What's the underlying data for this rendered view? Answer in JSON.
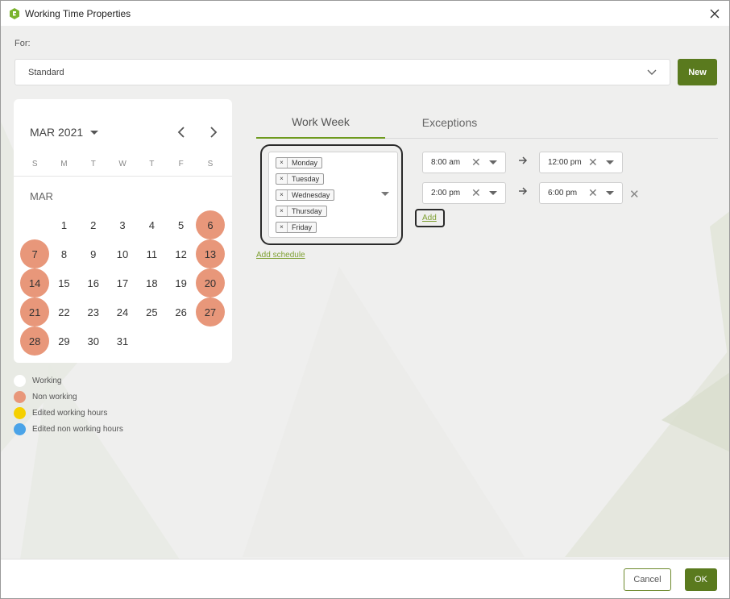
{
  "window": {
    "title": "Working Time Properties"
  },
  "for": {
    "label": "For:",
    "value": "Standard"
  },
  "new_button": "New",
  "calendar": {
    "month_year": "MAR 2021",
    "month_label": "MAR",
    "weekdays": [
      "S",
      "M",
      "T",
      "W",
      "T",
      "F",
      "S"
    ],
    "days": [
      "1",
      "2",
      "3",
      "4",
      "5",
      "6",
      "7",
      "8",
      "9",
      "10",
      "11",
      "12",
      "13",
      "14",
      "15",
      "16",
      "17",
      "18",
      "19",
      "20",
      "21",
      "22",
      "23",
      "24",
      "25",
      "26",
      "27",
      "28",
      "29",
      "30",
      "31"
    ],
    "non_working_days": [
      "6",
      "7",
      "13",
      "14",
      "20",
      "21",
      "27",
      "28"
    ]
  },
  "legend": [
    {
      "label": "Working",
      "color": "#ffffff"
    },
    {
      "label": "Non working",
      "color": "#e8977a"
    },
    {
      "label": "Edited working hours",
      "color": "#f5d000"
    },
    {
      "label": "Edited non working hours",
      "color": "#4aa3e8"
    }
  ],
  "tabs": [
    "Work Week",
    "Exceptions"
  ],
  "selected_days": [
    "Monday",
    "Tuesday",
    "Wednesday",
    "Thursday",
    "Friday"
  ],
  "add_schedule": "Add schedule",
  "time_rows": [
    {
      "from": "8:00 am",
      "to": "12:00 pm"
    },
    {
      "from": "2:00 pm",
      "to": "6:00 pm"
    }
  ],
  "add_link": "Add",
  "footer": {
    "cancel": "Cancel",
    "ok": "OK"
  },
  "colors": {
    "accent": "#5a7a1e",
    "link": "#7fa033",
    "non_working": "#e8977a"
  }
}
